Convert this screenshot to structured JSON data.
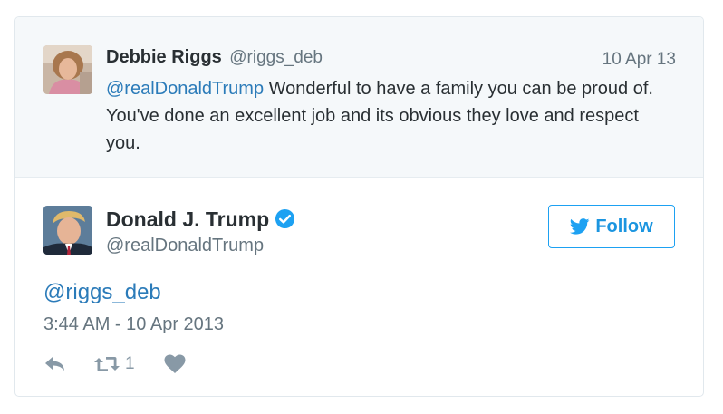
{
  "parent_tweet": {
    "name": "Debbie Riggs",
    "handle": "@riggs_deb",
    "date": "10 Apr 13",
    "mention": "@realDonaldTrump",
    "text": " Wonderful to have a family you can be proud of. You've done an excellent job and its obvious they love and respect you."
  },
  "tweet": {
    "name": "Donald J. Trump",
    "handle": "@realDonaldTrump",
    "verified": true,
    "follow_label": "Follow",
    "body": "@riggs_deb",
    "timestamp": "3:44 AM - 10 Apr 2013",
    "retweet_count": "1"
  },
  "colors": {
    "link": "#2b7bb9",
    "twitter_blue": "#1da1f2",
    "muted": "#66757f",
    "icon": "#8899a6"
  },
  "icons": [
    "reply-icon",
    "retweet-icon",
    "heart-icon",
    "bird-icon",
    "verified-badge-icon"
  ]
}
